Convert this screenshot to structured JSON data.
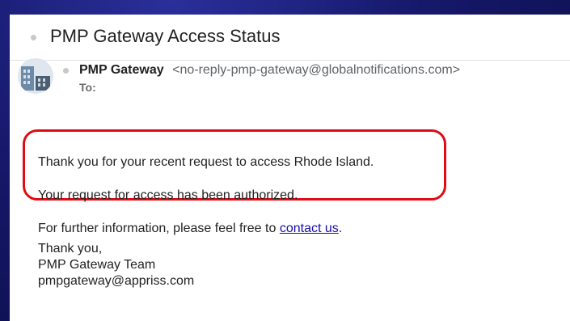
{
  "email": {
    "subject": "PMP Gateway Access Status",
    "sender_name": "PMP Gateway",
    "sender_email": "<no-reply-pmp-gateway@globalnotifications.com>",
    "to_label": "To:",
    "body": {
      "line1": "Thank you for your recent request to access Rhode Island.",
      "line2": "Your request for access has been authorized.",
      "line3_prefix": "For further information, please feel free to",
      "link_text": "contact us",
      "line3_suffix": "."
    },
    "signature": {
      "line1": "Thank you,",
      "line2": "PMP Gateway Team",
      "line3": "pmpgateway@appriss.com"
    }
  },
  "colors": {
    "background": "#16186a",
    "highlight": "#e10b14",
    "link": "#1a0dab"
  },
  "icons": [
    "building-avatar-icon",
    "bullet-icon"
  ]
}
